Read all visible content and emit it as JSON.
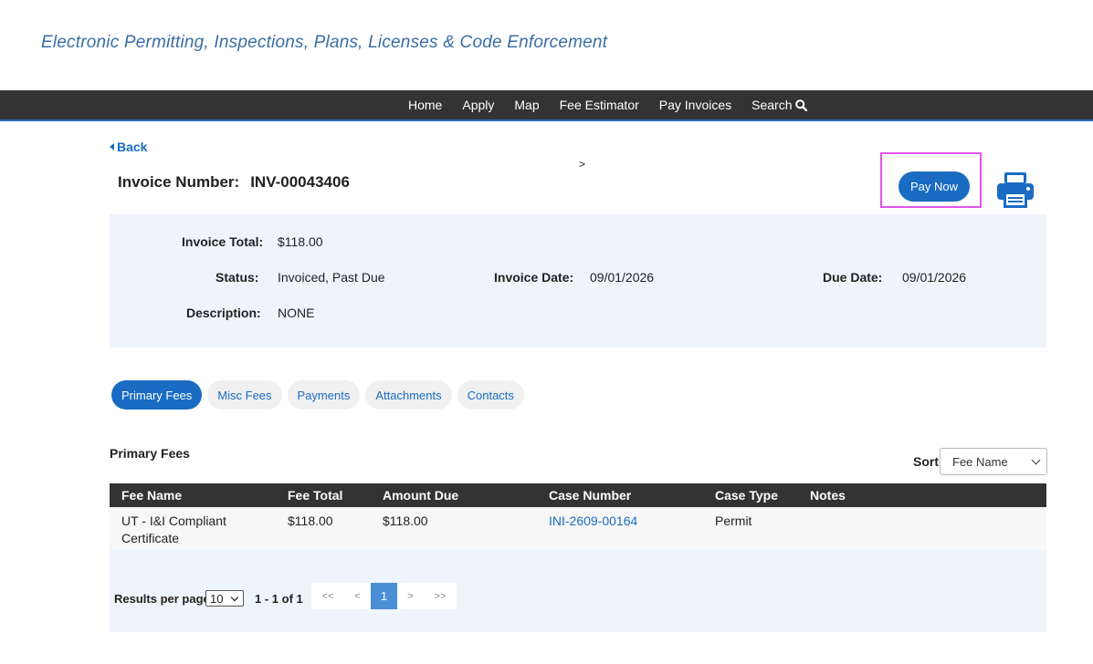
{
  "header": {
    "tagline": "Electronic Permitting, Inspections, Plans, Licenses & Code Enforcement"
  },
  "nav": {
    "items": [
      "Home",
      "Apply",
      "Map",
      "Fee Estimator",
      "Pay Invoices",
      "Search"
    ]
  },
  "page": {
    "back_label": "Back",
    "breadcrumb_separator": ">",
    "invoice_label": "Invoice Number:",
    "invoice_number": "INV-00043406",
    "pay_now_label": "Pay Now"
  },
  "details": {
    "total_label": "Invoice Total:",
    "total_value": "$118.00",
    "status_label": "Status:",
    "status_value": "Invoiced, Past Due",
    "invoice_date_label": "Invoice Date:",
    "invoice_date_value": "09/01/2026",
    "due_date_label": "Due Date:",
    "due_date_value": "09/01/2026",
    "description_label": "Description:",
    "description_value": "NONE"
  },
  "tabs": [
    "Primary Fees",
    "Misc Fees",
    "Payments",
    "Attachments",
    "Contacts"
  ],
  "fees": {
    "section_title": "Primary Fees",
    "sort_label": "Sort",
    "sort_selected": "Fee Name",
    "columns": [
      "Fee Name",
      "Fee Total",
      "Amount Due",
      "Case Number",
      "Case Type",
      "Notes"
    ],
    "rows": [
      {
        "fee_name_line1": "UT - I&I Compliant",
        "fee_name_line2": "Certificate",
        "fee_total": "$118.00",
        "amount_due": "$118.00",
        "case_number": "INI-2609-00164",
        "case_type": "Permit",
        "notes": ""
      }
    ]
  },
  "pager": {
    "results_per_page_label": "Results per page",
    "results_per_page_value": "10",
    "range_text": "1 - 1 of 1",
    "first": "<<",
    "prev": "<",
    "current": "1",
    "next": ">",
    "last": ">>"
  },
  "colors": {
    "accent": "#1a6cc2",
    "navbar": "#333333",
    "panel": "#eef4fb",
    "highlight": "#e055e8"
  }
}
